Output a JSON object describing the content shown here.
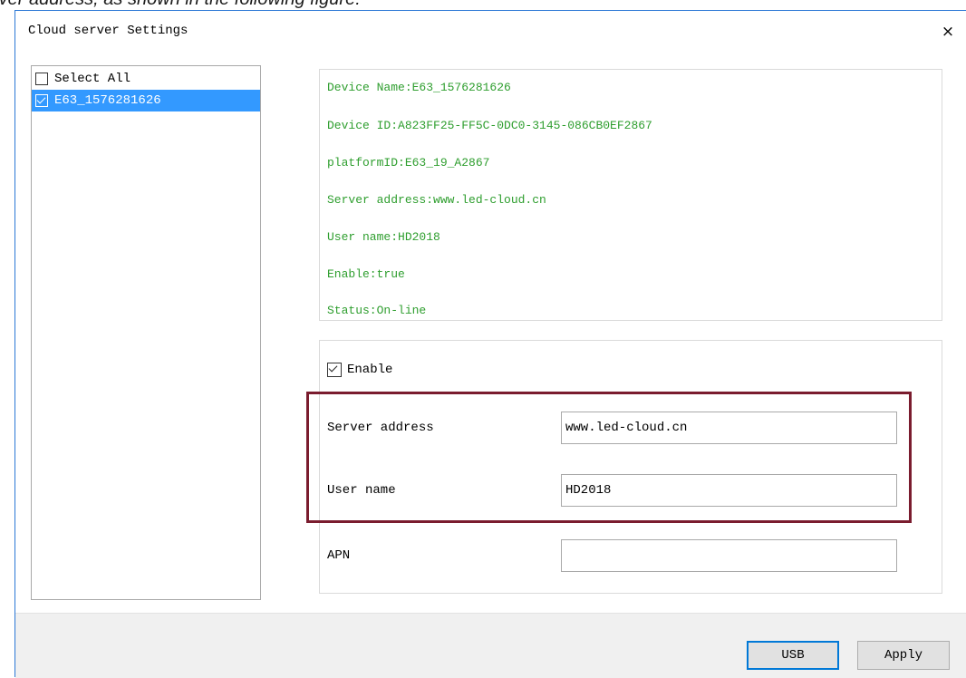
{
  "caption": "rver address, as shown in the following figure:",
  "window": {
    "title": "Cloud server Settings",
    "close_label": "×"
  },
  "device_list": {
    "items": [
      {
        "label": "Select All",
        "checked": false,
        "selected": false
      },
      {
        "label": "E63_1576281626",
        "checked": true,
        "selected": true
      }
    ]
  },
  "device_info": {
    "device_name": "Device Name:E63_1576281626",
    "device_id": "Device ID:A823FF25-FF5C-0DC0-3145-086CB0EF2867",
    "platform_id": "platformID:E63_19_A2867",
    "server_address": "Server address:www.led-cloud.cn",
    "user_name": "User name:HD2018",
    "enable": "Enable:true",
    "status": "Status:On-line"
  },
  "settings": {
    "enable_label": "Enable",
    "enable_checked": true,
    "server_address_label": "Server address",
    "server_address_value": "www.led-cloud.cn",
    "user_name_label": "User name",
    "user_name_value": "HD2018",
    "apn_label": "APN",
    "apn_value": ""
  },
  "buttons": {
    "usb": "USB",
    "apply": "Apply"
  },
  "colors": {
    "info_text": "#2e9e2e",
    "selection": "#3399ff",
    "highlight": "#7a1c2e",
    "window_border": "#2b78d6"
  }
}
